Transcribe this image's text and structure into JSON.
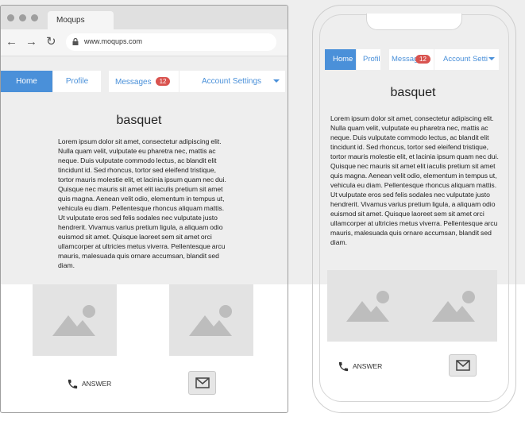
{
  "browser": {
    "tab_title": "Moqups",
    "url": "www.moqups.com"
  },
  "nav": {
    "home": "Home",
    "profile": "Profile",
    "messages": "Messages",
    "messages_badge": "12",
    "account_settings": "Account Settings"
  },
  "mobile_nav": {
    "home": "Home",
    "profile": "Profile",
    "messages": "Messages",
    "messages_badge": "12",
    "account_settings": "Account Settings"
  },
  "content": {
    "title": "basquet",
    "body": "Lorem ipsum dolor sit amet, consectetur adipiscing elit. Nulla quam velit, vulputate eu pharetra nec, mattis ac neque. Duis vulputate commodo lectus, ac blandit elit tincidunt id. Sed rhoncus, tortor sed eleifend tristique, tortor mauris molestie elit, et lacinia ipsum quam nec dui. Quisque nec mauris sit amet elit iaculis pretium sit amet quis magna. Aenean velit odio, elementum in tempus ut, vehicula eu diam. Pellentesque rhoncus aliquam mattis. Ut vulputate eros sed felis sodales nec vulputate justo hendrerit. Vivamus varius pretium ligula, a aliquam odio euismod sit amet. Quisque laoreet sem sit amet orci ullamcorper at ultricies metus viverra. Pellentesque arcu mauris, malesuada quis ornare accumsan, blandit sed diam."
  },
  "footer": {
    "answer_label": "ANSWER"
  },
  "colors": {
    "accent": "#4a90d9",
    "badge": "#d9534f",
    "placeholder": "#e3e3e3",
    "page_band": "#eeeeee"
  }
}
